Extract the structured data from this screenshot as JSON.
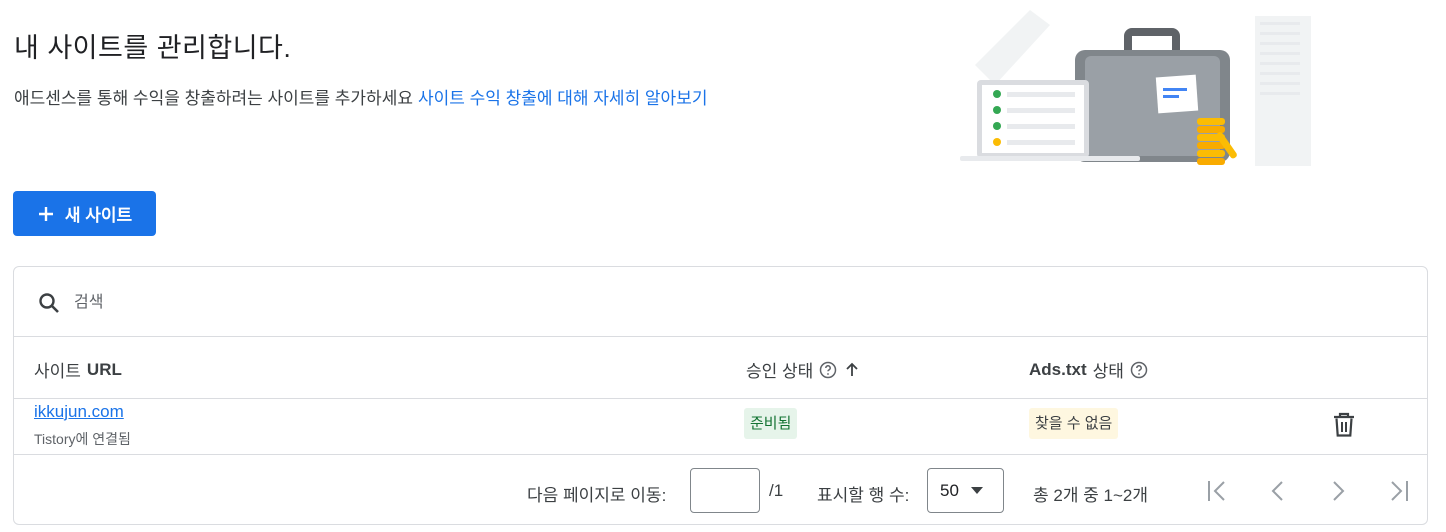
{
  "header": {
    "title": "내 사이트를 관리합니다.",
    "description": "애드센스를 통해 수익을 창출하려는 사이트를 추가하세요",
    "learn_more_link": "사이트 수익 창출에 대해 자세히 알아보기"
  },
  "toolbar": {
    "new_site_label": "새 사이트"
  },
  "search": {
    "placeholder": "검색"
  },
  "table": {
    "columns": {
      "site_url_prefix": "사이트",
      "site_url_suffix": "URL",
      "approval_status": "승인 상태",
      "ads_txt_prefix": "Ads.txt",
      "ads_txt_suffix": "상태"
    },
    "rows": [
      {
        "site": "ikkujun.com",
        "connected_via": "Tistory에 연결됨",
        "approval_status": "준비됨",
        "ads_txt_status": "찾을 수 없음"
      }
    ]
  },
  "pagination": {
    "go_to_page_label": "다음 페이지로 이동:",
    "page_input_value": "",
    "total_pages": "/1",
    "rows_per_page_label": "표시할 행 수:",
    "rows_per_page_value": "50",
    "range_text": "총 2개 중 1~2개"
  },
  "colors": {
    "accent": "#1a73e8",
    "ready_bg": "#e6f4ea",
    "ready_text": "#137333",
    "warning_bg": "#fef7e0"
  },
  "icons": [
    "plus-icon",
    "search-icon",
    "help-icon",
    "arrow-up-icon",
    "trash-icon",
    "caret-down-icon",
    "first-page-icon",
    "prev-page-icon",
    "next-page-icon",
    "last-page-icon"
  ]
}
